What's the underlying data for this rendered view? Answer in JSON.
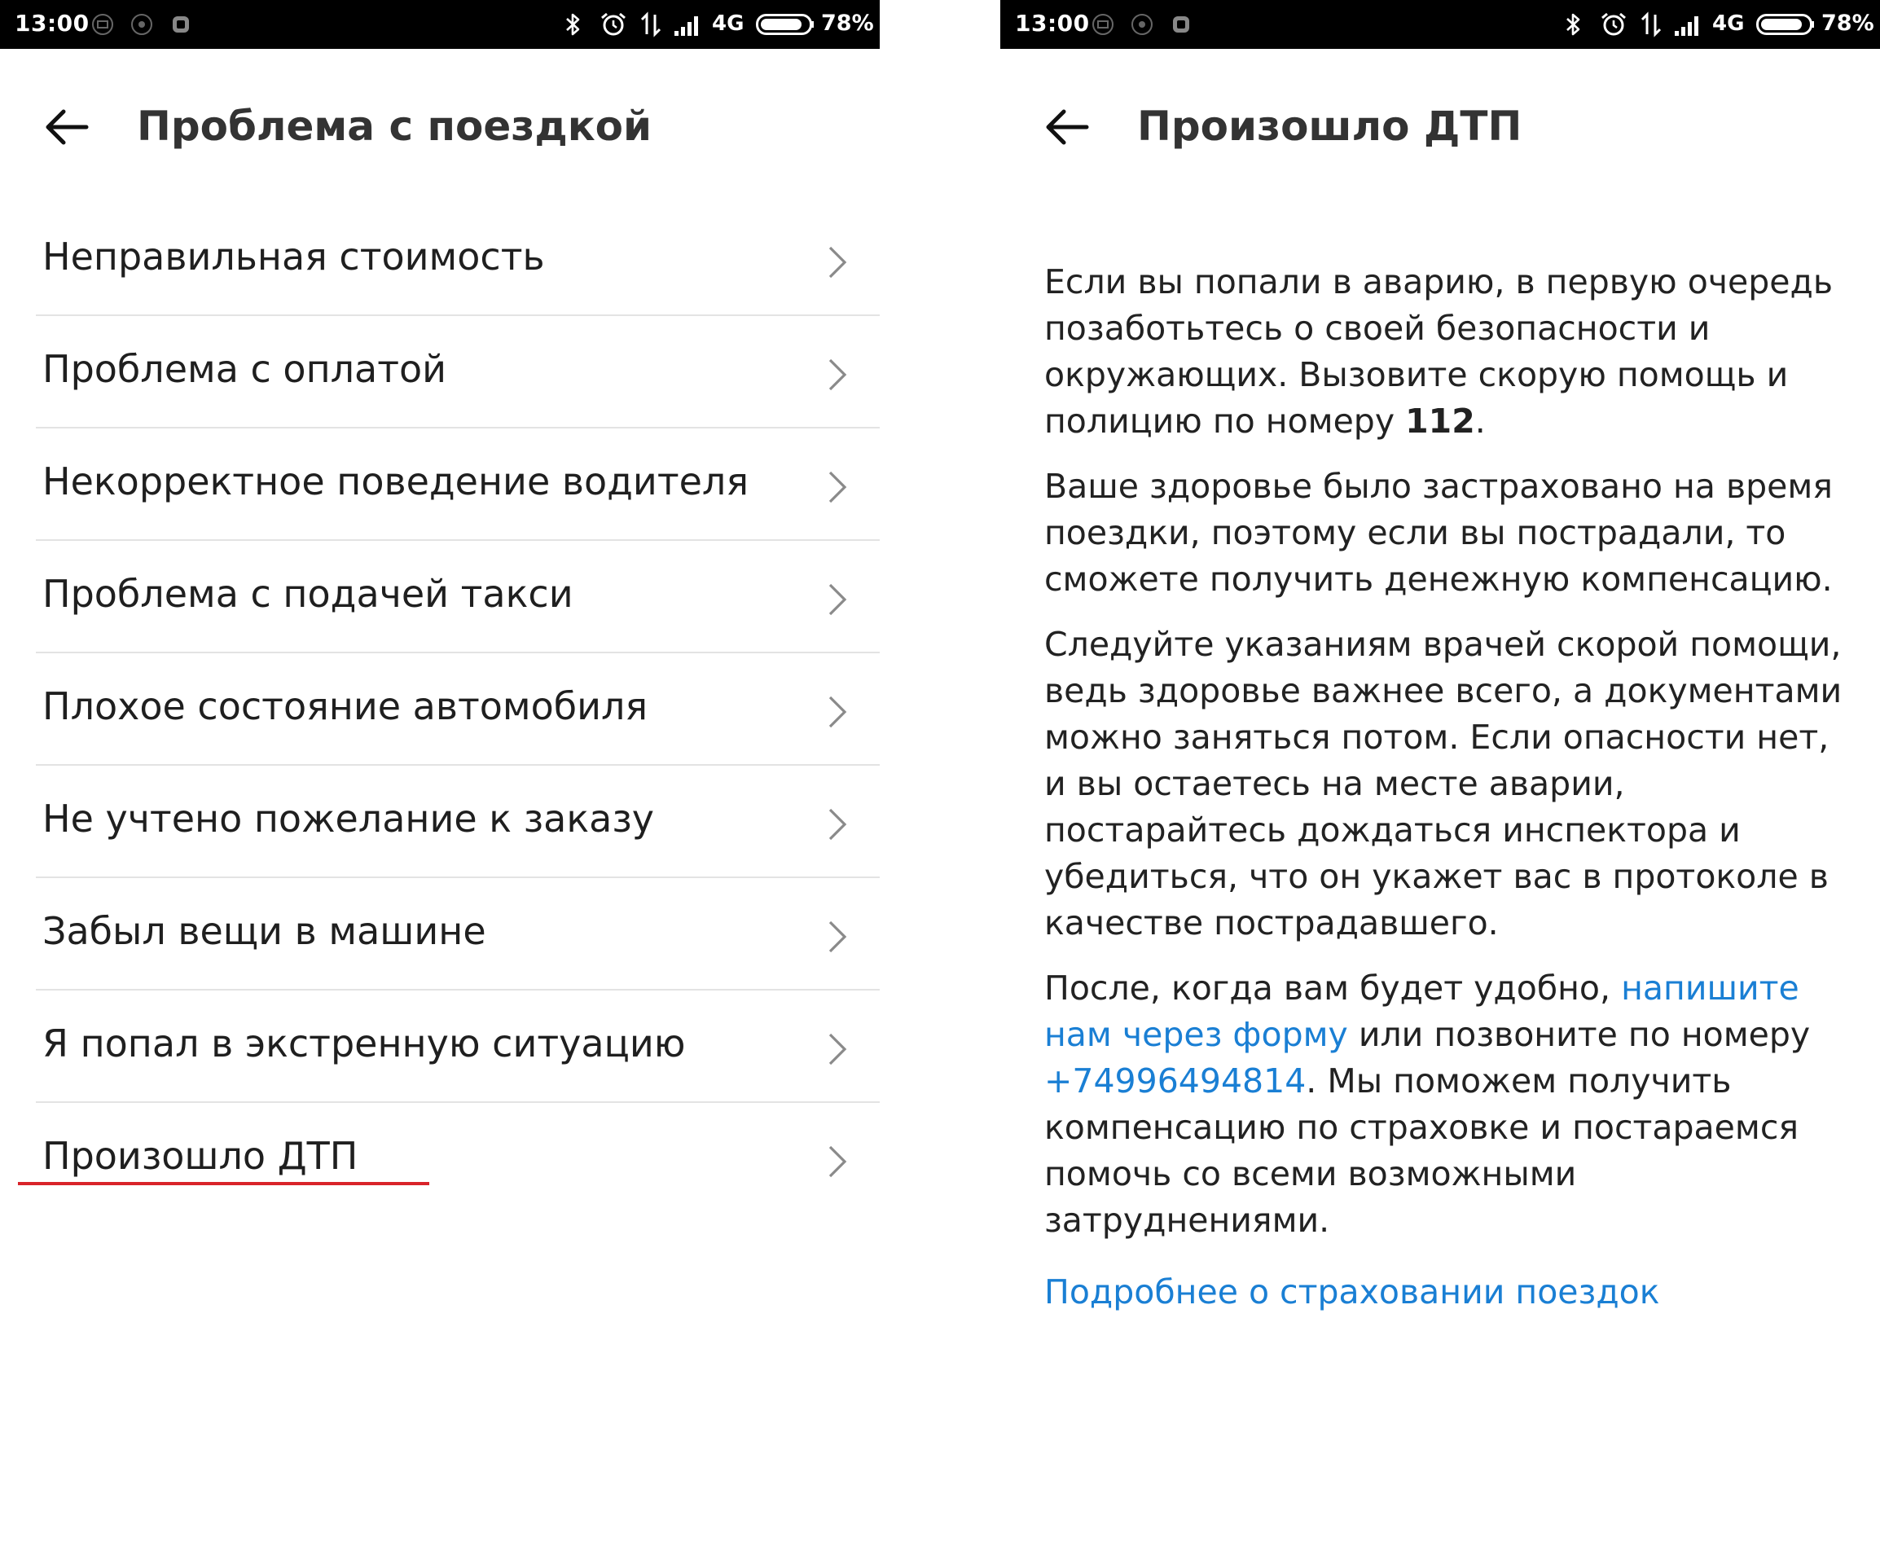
{
  "status_bar": {
    "time": "13:00",
    "network": "4G",
    "battery": "78%",
    "icons": [
      "bluetooth-icon",
      "alarm-icon",
      "data-arrows-icon",
      "signal-icon",
      "battery-icon"
    ]
  },
  "colors": {
    "link": "#1a7fd4",
    "highlight_underline": "#d9232a",
    "divider": "#e3e3e3"
  },
  "left_screen": {
    "title": "Проблема с поездкой",
    "menu_items": [
      "Неправильная стоимость",
      "Проблема с оплатой",
      "Некорректное поведение водителя",
      "Проблема с подачей такси",
      "Плохое состояние автомобиля",
      "Не учтено пожелание к заказу",
      "Забыл вещи в машине",
      "Я попал в экстренную ситуацию",
      "Произошло ДТП"
    ]
  },
  "right_screen": {
    "title": "Произошло ДТП",
    "p1_text": "Если вы попали в аварию, в первую очередь позаботьтесь о своей безопасности и окружающих. Вызовите скорую помощь и полицию по номеру ",
    "p1_number": "112",
    "p1_end": ".",
    "p2": "Ваше здоровье было застраховано на время поездки, поэтому если вы пострадали, то сможете получить денежную компенсацию.",
    "p3": "Следуйте указаниям врачей скорой помощи, ведь здоровье важнее всего, а документами можно заняться потом. Если опасности нет, и вы остаетесь на месте аварии, постарайтесь дождаться инспектора и убедиться, что он укажет вас в протоколе в качестве пострадавшего.",
    "p4_start": "После, когда вам будет удобно, ",
    "p4_link_form": "напишите нам через форму",
    "p4_mid": " или позвоните по номеру ",
    "p4_link_phone": "+74996494814",
    "p4_end": ". Мы поможем получить компенсацию по страховке и постараемся помочь со всеми возможными затруднениями.",
    "more_link": "Подробнее о страховании поездок"
  }
}
